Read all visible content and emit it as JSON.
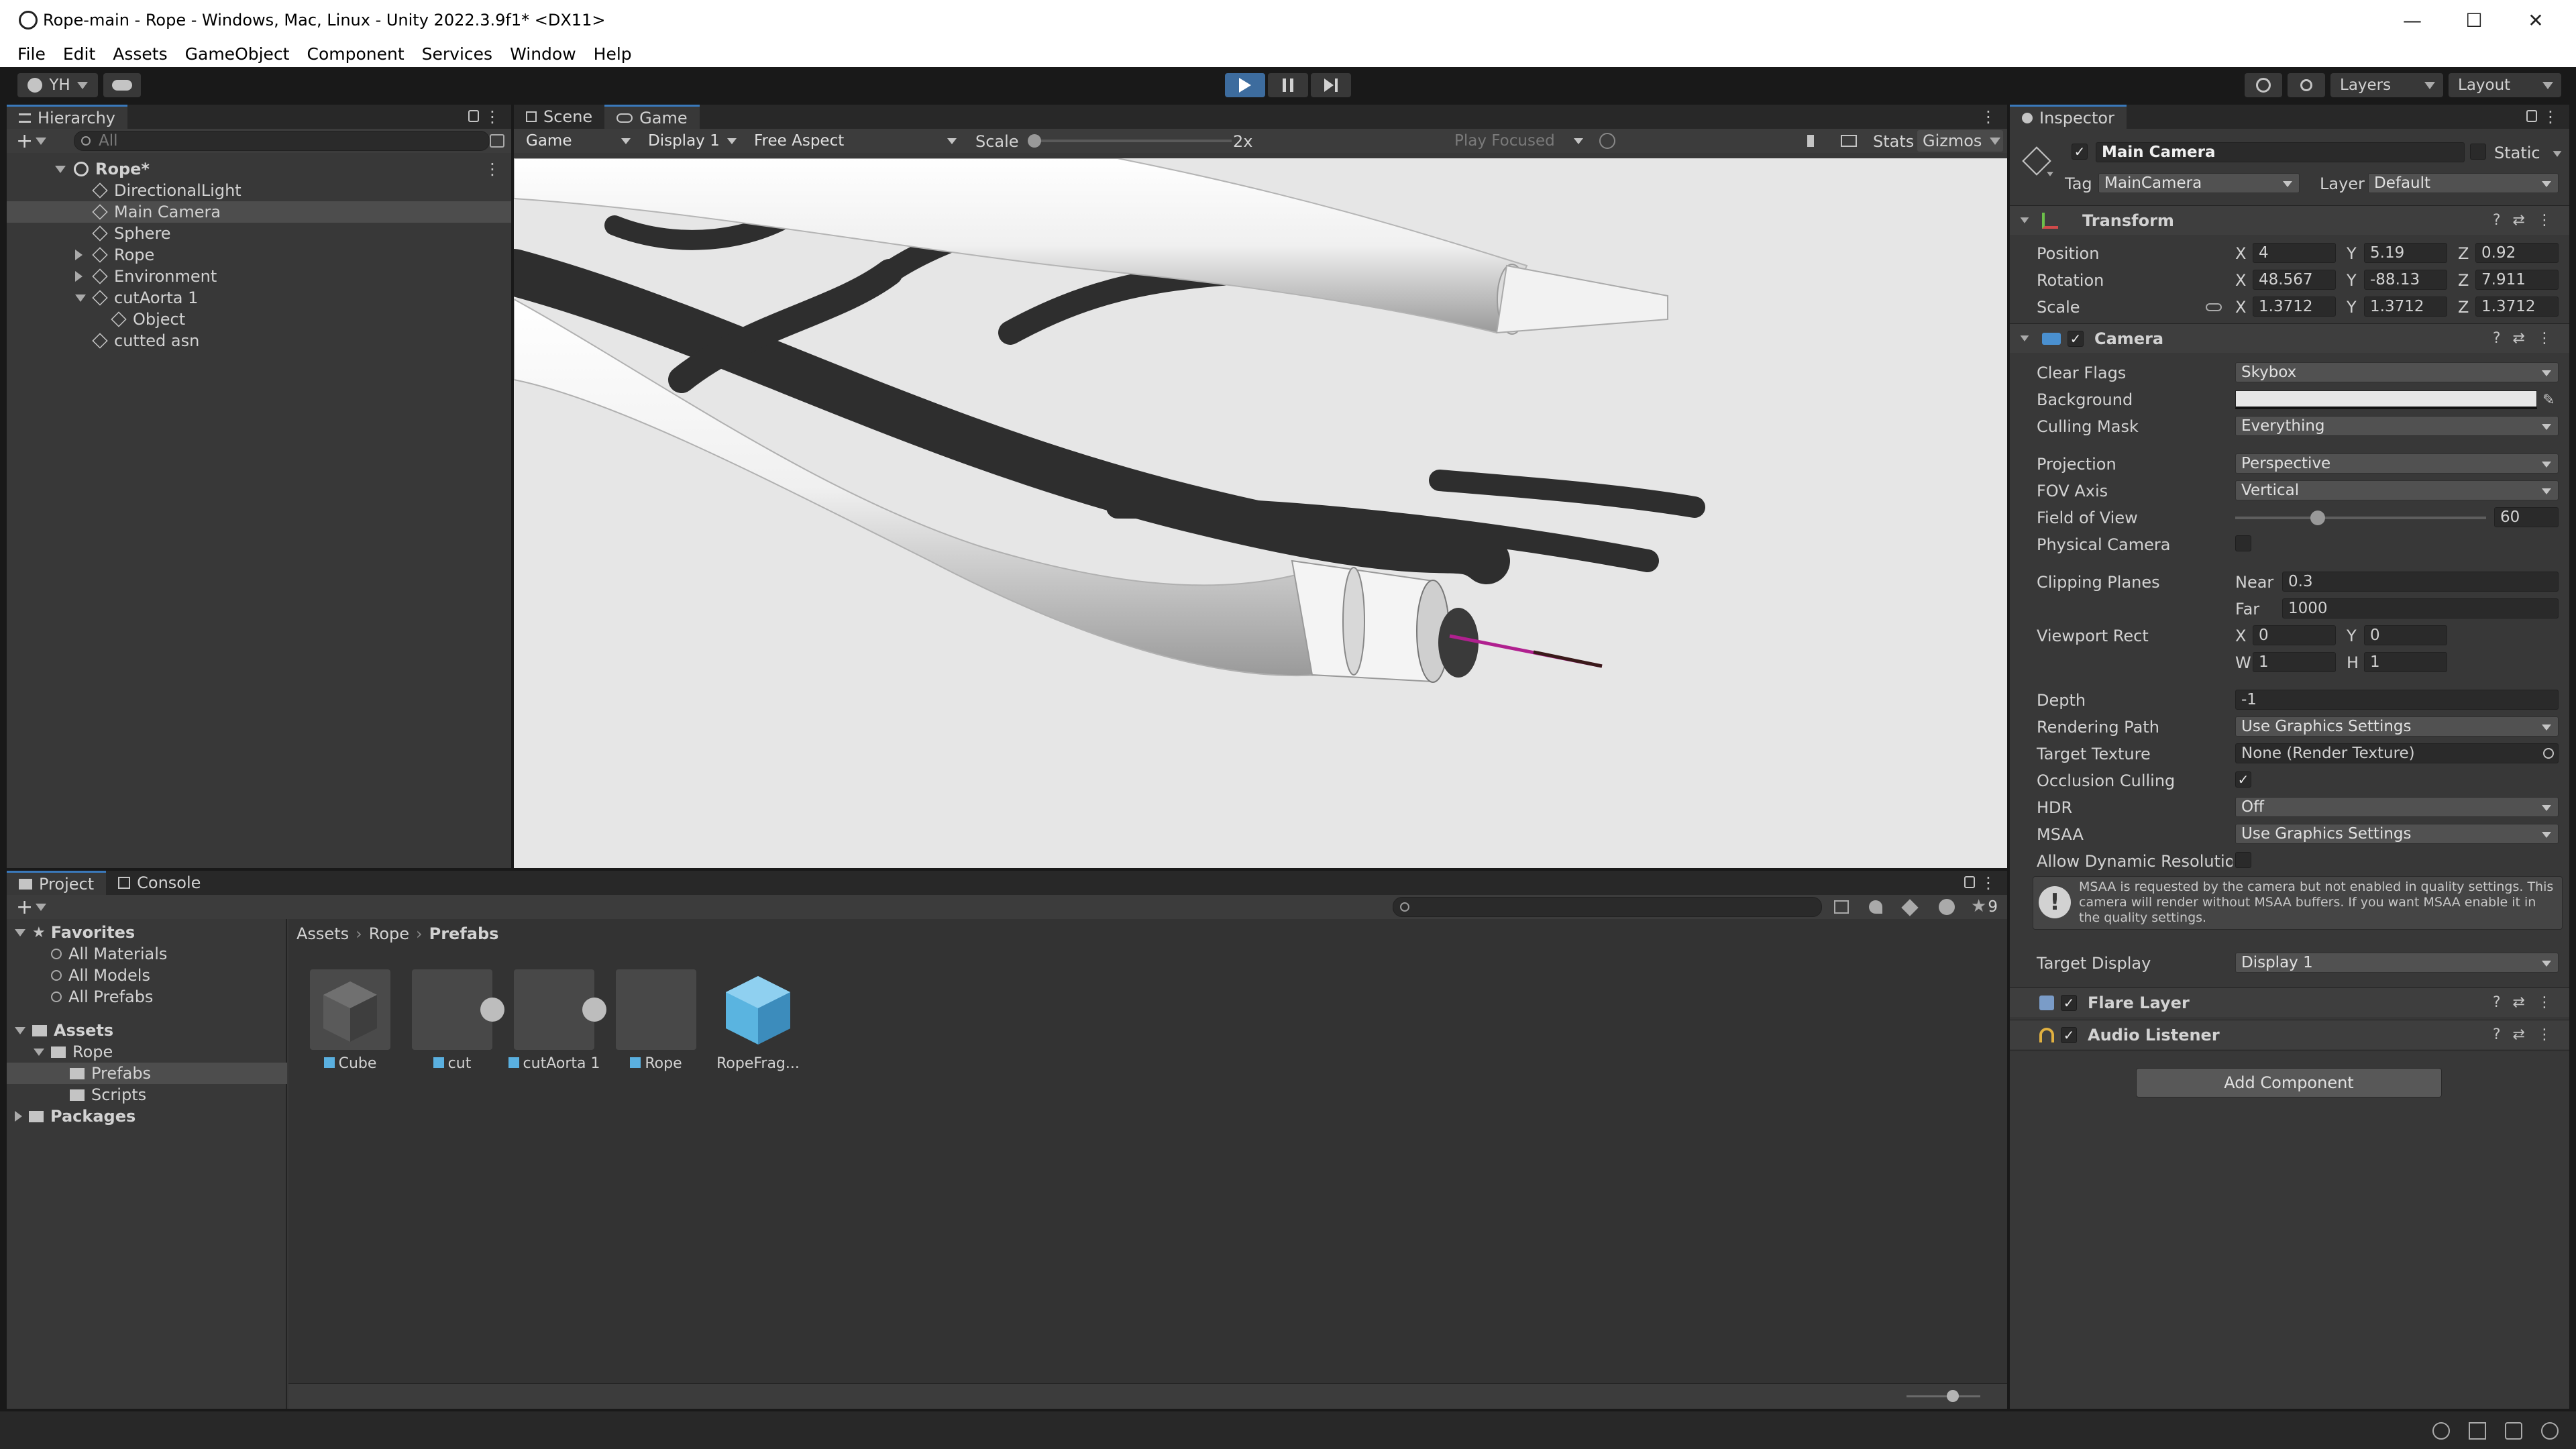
{
  "window": {
    "title": "Rope-main - Rope - Windows, Mac, Linux - Unity 2022.3.9f1* <DX11>",
    "controls": [
      "—",
      "☐",
      "✕"
    ]
  },
  "menu": [
    "File",
    "Edit",
    "Assets",
    "GameObject",
    "Component",
    "Services",
    "Window",
    "Help"
  ],
  "toolbar": {
    "account": "YH",
    "layers": "Layers",
    "layout": "Layout"
  },
  "hierarchy": {
    "tab": "Hierarchy",
    "search_placeholder": "All",
    "scene": "Rope*",
    "items": [
      {
        "label": "DirectionalLight",
        "depth": 1,
        "expand": "none"
      },
      {
        "label": "Main Camera",
        "depth": 1,
        "expand": "none",
        "selected": true
      },
      {
        "label": "Sphere",
        "depth": 1,
        "expand": "none"
      },
      {
        "label": "Rope",
        "depth": 1,
        "expand": "collapsed"
      },
      {
        "label": "Environment",
        "depth": 1,
        "expand": "collapsed"
      },
      {
        "label": "cutAorta 1",
        "depth": 1,
        "expand": "expanded"
      },
      {
        "label": "Object",
        "depth": 2,
        "expand": "none"
      },
      {
        "label": "cutted asn",
        "depth": 1,
        "expand": "none"
      }
    ]
  },
  "game": {
    "tabs": [
      "Scene",
      "Game"
    ],
    "active_tab": "Game",
    "mode": "Game",
    "display": "Display 1",
    "aspect": "Free Aspect",
    "scale_label": "Scale",
    "scale_value": "2x",
    "play_focused": "Play Focused",
    "stats": "Stats",
    "gizmos": "Gizmos"
  },
  "project": {
    "tabs": [
      "Project",
      "Console"
    ],
    "favorites_label": "Favorites",
    "favorites": [
      "All Materials",
      "All Models",
      "All Prefabs"
    ],
    "assets_label": "Assets",
    "tree": [
      "Rope",
      "Prefabs",
      "Scripts"
    ],
    "packages_label": "Packages",
    "breadcrumb": [
      "Assets",
      "Rope",
      "Prefabs"
    ],
    "hidden_count": "9",
    "assets": [
      "Cube",
      "cut",
      "cutAorta 1",
      "Rope",
      "RopeFrag..."
    ]
  },
  "inspector": {
    "tab": "Inspector",
    "object_name": "Main Camera",
    "static_label": "Static",
    "tag_label": "Tag",
    "tag_value": "MainCamera",
    "layer_label": "Layer",
    "layer_value": "Default",
    "transform": {
      "title": "Transform",
      "position": {
        "label": "Position",
        "x": "4",
        "y": "5.19",
        "z": "0.92"
      },
      "rotation": {
        "label": "Rotation",
        "x": "48.567",
        "y": "-88.13",
        "z": "7.911"
      },
      "scale": {
        "label": "Scale",
        "x": "1.3712",
        "y": "1.3712",
        "z": "1.3712"
      }
    },
    "camera": {
      "title": "Camera",
      "clear_flags": {
        "label": "Clear Flags",
        "value": "Skybox"
      },
      "background": {
        "label": "Background"
      },
      "culling_mask": {
        "label": "Culling Mask",
        "value": "Everything"
      },
      "projection": {
        "label": "Projection",
        "value": "Perspective"
      },
      "fov_axis": {
        "label": "FOV Axis",
        "value": "Vertical"
      },
      "fov": {
        "label": "Field of View",
        "value": "60",
        "slider_fraction": 0.33
      },
      "physical": {
        "label": "Physical Camera"
      },
      "clipping": {
        "label": "Clipping Planes",
        "near_label": "Near",
        "near": "0.3",
        "far_label": "Far",
        "far": "1000"
      },
      "viewport": {
        "label": "Viewport Rect",
        "x": "0",
        "y": "0",
        "w": "1",
        "h": "1"
      },
      "depth": {
        "label": "Depth",
        "value": "-1"
      },
      "rendering_path": {
        "label": "Rendering Path",
        "value": "Use Graphics Settings"
      },
      "target_texture": {
        "label": "Target Texture",
        "value": "None (Render Texture)"
      },
      "occlusion": {
        "label": "Occlusion Culling"
      },
      "hdr": {
        "label": "HDR",
        "value": "Off"
      },
      "msaa": {
        "label": "MSAA",
        "value": "Use Graphics Settings"
      },
      "dynamic_res": {
        "label": "Allow Dynamic Resolution"
      },
      "warning": "MSAA is requested by the camera but not enabled in quality settings. This camera will render without MSAA buffers. If you want MSAA enable it in the quality settings.",
      "target_display": {
        "label": "Target Display",
        "value": "Display 1"
      }
    },
    "flare_layer": "Flare Layer",
    "audio_listener": "Audio Listener",
    "add_component": "Add Component"
  },
  "colors": {
    "accent": "#3a79bb",
    "play_active": "#3d6c9e",
    "viewport_bg": "#e6e6e6",
    "line_pink": "#b0208f"
  }
}
